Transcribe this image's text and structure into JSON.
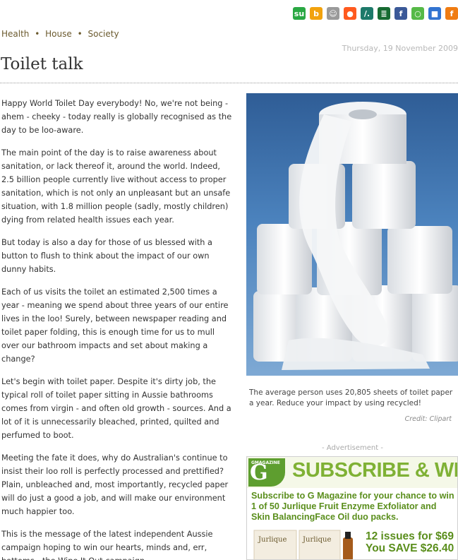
{
  "share": {
    "icons": [
      {
        "name": "stumbleupon-icon",
        "glyph": "su",
        "color": "#2aa843"
      },
      {
        "name": "buzz-icon",
        "glyph": "b",
        "color": "#f2a20d"
      },
      {
        "name": "people-icon",
        "glyph": "☺",
        "color": "#9a9a9a"
      },
      {
        "name": "reddit-icon",
        "glyph": "●",
        "color": "#ff5a1f"
      },
      {
        "name": "slashdot-icon",
        "glyph": "/.",
        "color": "#1e7a6a"
      },
      {
        "name": "newsvine-icon",
        "glyph": "≣",
        "color": "#176b32"
      },
      {
        "name": "facebook-icon",
        "glyph": "f",
        "color": "#3b5998"
      },
      {
        "name": "speech-bubble-icon",
        "glyph": "○",
        "color": "#56b947"
      },
      {
        "name": "delicious-icon",
        "glyph": "■",
        "color": "#3274d1"
      },
      {
        "name": "fark-icon",
        "glyph": "f",
        "color": "#f07c12"
      }
    ]
  },
  "breadcrumb": {
    "items": [
      "Health",
      "House",
      "Society"
    ],
    "separator": "•"
  },
  "article": {
    "date": "Thursday, 19 November 2009",
    "title": "Toilet talk",
    "paragraphs": [
      "Happy World Toilet Day everybody! No, we're not being - ahem - cheeky - today really is globally recognised as the day to be loo-aware.",
      "The main point of the day is to raise awareness about sanitation, or lack thereof it, around the world. Indeed, 2.5 billion people currently live without access to proper sanitation, which is not only an unpleasant but an unsafe situation, with 1.8 million people (sadly, mostly children) dying from related health issues each year.",
      "But today is also a day for those of us blessed with a button to flush to think about the impact of our own dunny habits.",
      "Each of us visits the toilet an estimated 2,500 times a year - meaning we spend about three years of our entire lives in the loo! Surely, between newspaper reading and toilet paper folding, this is enough time for us to mull over our bathroom impacts and set about making a change?",
      "Let's begin with toilet paper. Despite it's dirty job, the typical roll of toilet paper sitting in Aussie bathrooms comes from virgin - and often old growth - sources. And a lot of it is unnecessarily bleached, printed, quilted and perfumed to boot.",
      "Meeting the fate it does, why do Australian's continue to insist their loo roll is perfectly processed and prettified? Plain, unbleached and, most importantly, recycled paper will do just a good a job, and will make our environment much happier too.",
      "This is the message of the latest independent Aussie campaign hoping to win our hearts, minds and, err, bottoms - the Wipe It Out campaign."
    ]
  },
  "photo": {
    "caption": "The average person uses 20,805 sheets of toilet paper a year. Reduce your impact by using recycled!",
    "credit": "Credit: Clipart"
  },
  "ad": {
    "label": "- Advertisement -",
    "badge_top": "GMAGAZINE",
    "badge_letter": "G",
    "headline": "SUBSCRIBE & WIN",
    "body": "Subscribe to G Magazine for your chance to win 1 of 50 Jurlique Fruit Enzyme Exfoliator and Skin BalancingFace Oil duo packs.",
    "price_line1": "12 issues for $69",
    "price_line2": "You SAVE $26.40",
    "product_brand": "Jurlique"
  }
}
